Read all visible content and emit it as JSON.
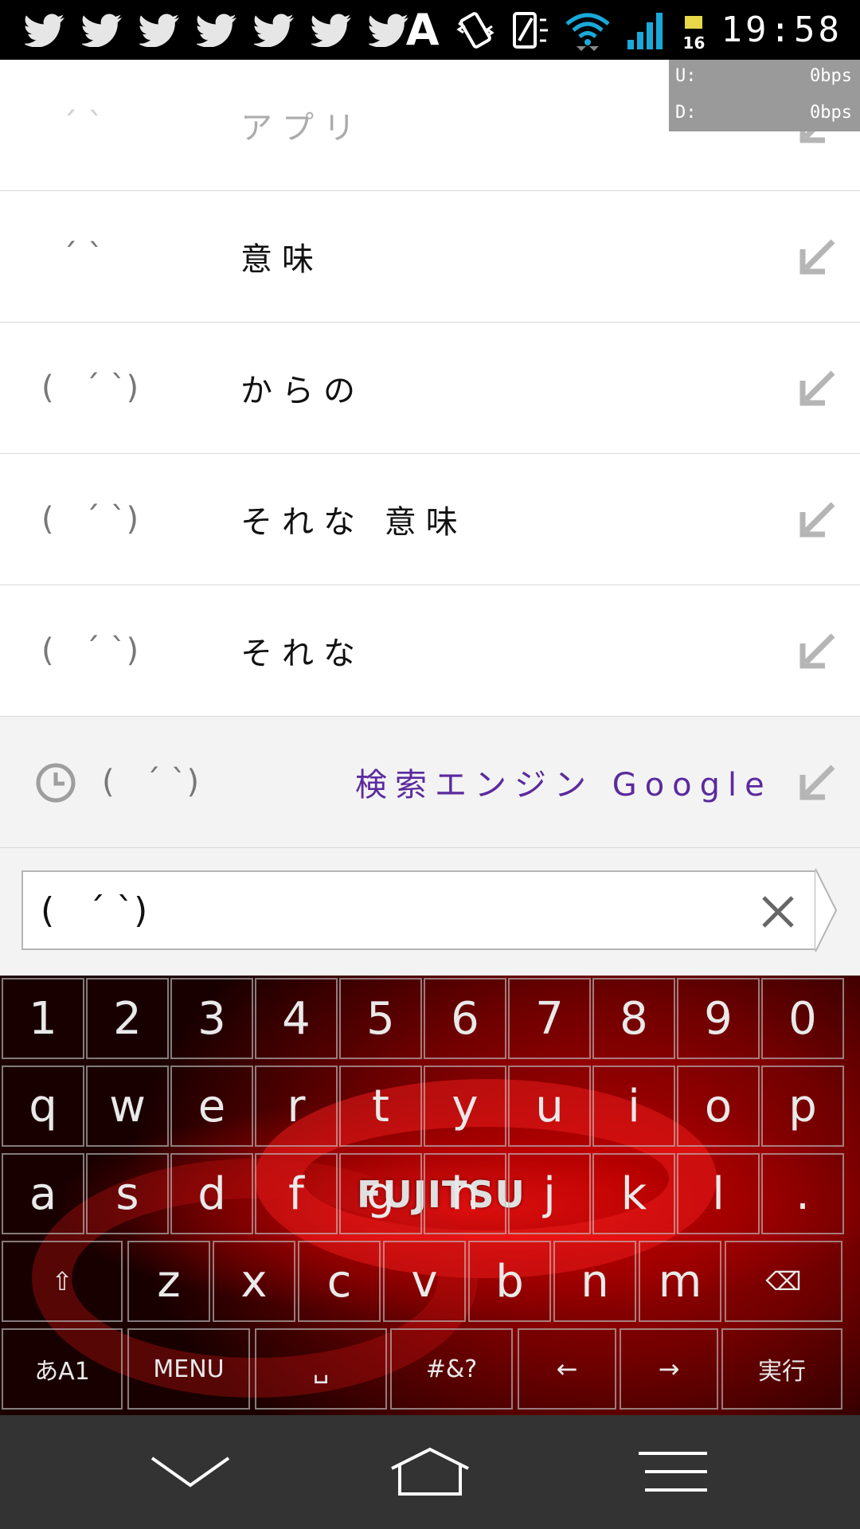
{
  "status_bar": {
    "notification_icons": [
      "twitter-icon",
      "twitter-icon",
      "twitter-icon",
      "twitter-icon",
      "twitter-icon",
      "twitter-icon",
      "twitter-icon"
    ],
    "input_indicator": "A",
    "battery_level": "16",
    "time": "19:58"
  },
  "network_monitor": {
    "upload_label": "U:",
    "upload_value": "0bps",
    "download_label": "D:",
    "download_value": "0bps"
  },
  "suggestions": [
    {
      "face": "  ´ `",
      "text": "アプリ",
      "faded": true
    },
    {
      "face": "  ´ `",
      "text": "意味"
    },
    {
      "face": "(   ´ `)",
      "text": "からの"
    },
    {
      "face": "(   ´ `)",
      "text": "それな 意味"
    },
    {
      "face": "(   ´ `)",
      "text": "それな"
    }
  ],
  "history_item": {
    "face": "(   ´ `)",
    "text": "検索エンジン Google",
    "text_color": "#5b2a9e"
  },
  "search": {
    "value": "(   ´ `)"
  },
  "keyboard": {
    "brand": "FUJITSU",
    "row_numbers": [
      "1",
      "2",
      "3",
      "4",
      "5",
      "6",
      "7",
      "8",
      "9",
      "0"
    ],
    "row_top": [
      "q",
      "w",
      "e",
      "r",
      "t",
      "y",
      "u",
      "i",
      "o",
      "p"
    ],
    "row_mid": [
      "a",
      "s",
      "d",
      "f",
      "g",
      "h",
      "j",
      "k",
      "l",
      "."
    ],
    "row_bottom": [
      "z",
      "x",
      "c",
      "v",
      "b",
      "n",
      "m"
    ],
    "mode_key": "あA1",
    "menu_key": "MENU",
    "space_key": "␣",
    "symbols_key": "#&?",
    "left_key": "←",
    "right_key": "→",
    "enter_key": "実行",
    "shift_key": "⇧",
    "backspace_key": "⌫"
  },
  "colors": {
    "status_bar": "#000000",
    "nav_bar": "#333333",
    "keyboard_accent": "#c80000"
  }
}
